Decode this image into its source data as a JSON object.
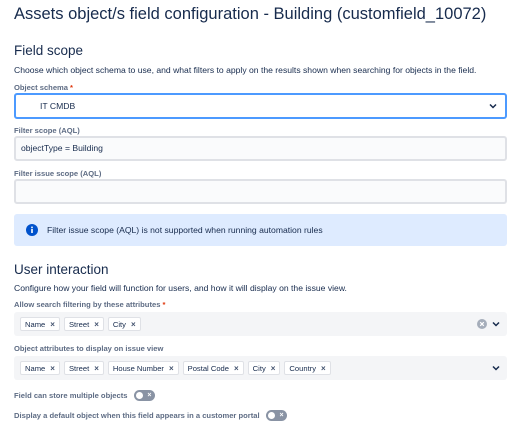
{
  "page": {
    "title": "Assets object/s field configuration - Building (customfield_10072)"
  },
  "field_scope": {
    "title": "Field scope",
    "description": "Choose which object schema to use, and what filters to apply on the results shown when searching for objects in the field.",
    "schema_label": "Object schema",
    "required_mark": "*",
    "schema_value": "IT CMDB",
    "filter_scope_label": "Filter scope (AQL)",
    "filter_scope_value": "objectType = Building",
    "filter_issue_label": "Filter issue scope (AQL)",
    "filter_issue_value": "",
    "info_message": "Filter issue scope (AQL) is not supported when running automation rules"
  },
  "user_interaction": {
    "title": "User interaction",
    "description": "Configure how your field will function for users, and how it will display on the issue view.",
    "search_filter_label": "Allow search filtering by these attributes",
    "required_mark": "*",
    "search_filter_chips": [
      "Name",
      "Street",
      "City"
    ],
    "display_attrs_label": "Object attributes to display on issue view",
    "display_attrs_chips": [
      "Name",
      "Street",
      "House Number",
      "Postal Code",
      "City",
      "Country"
    ],
    "multiple_label": "Field can store multiple objects",
    "multiple_enabled": false,
    "default_label": "Display a default object when this field appears in a customer portal",
    "default_enabled": false
  },
  "colors": {
    "accent": "#4c9aff",
    "info_bg": "#deebff",
    "info_icon": "#0052cc",
    "required": "#de350b"
  }
}
